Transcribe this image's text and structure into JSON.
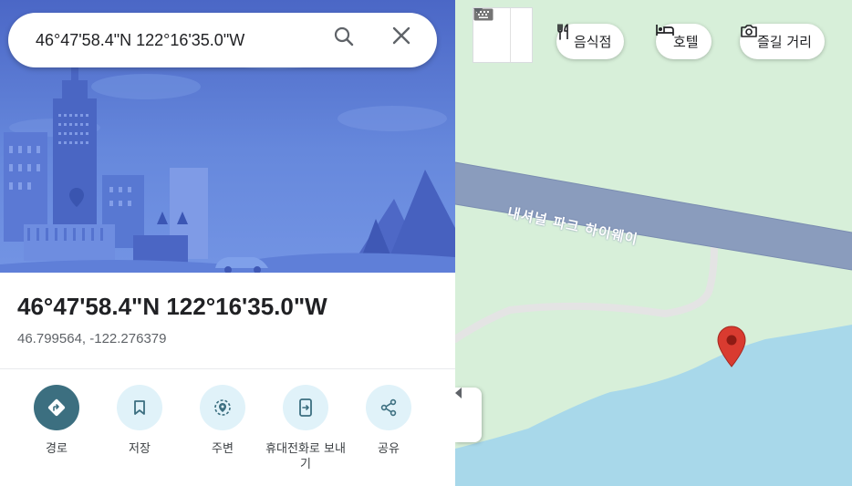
{
  "search": {
    "value": "46°47'58.4\"N 122°16'35.0\"W",
    "icons": [
      "search-icon",
      "close-icon"
    ]
  },
  "place": {
    "title": "46°47'58.4\"N 122°16'35.0\"W",
    "coordinates": "46.799564, -122.276379"
  },
  "actions": [
    {
      "label": "경로",
      "icon": "directions-icon"
    },
    {
      "label": "저장",
      "icon": "bookmark-icon"
    },
    {
      "label": "주변",
      "icon": "nearby-icon"
    },
    {
      "label": "휴대전화로 보내기",
      "icon": "send-to-phone-icon"
    },
    {
      "label": "공유",
      "icon": "share-icon"
    }
  ],
  "map": {
    "road_label": "내셔널 파크 하이웨이",
    "chips": [
      {
        "label": "음식점",
        "icon": "restaurant-icon"
      },
      {
        "label": "호텔",
        "icon": "hotel-icon"
      },
      {
        "label": "즐길 거리",
        "icon": "camera-icon"
      }
    ]
  },
  "colors": {
    "primary_action": "#3c6f80",
    "action_circle": "#e0f2f9",
    "map_land": "#d7efd9",
    "map_water": "#a8d8ea",
    "road": "#8a9cbd",
    "marker": "#d93b30"
  }
}
